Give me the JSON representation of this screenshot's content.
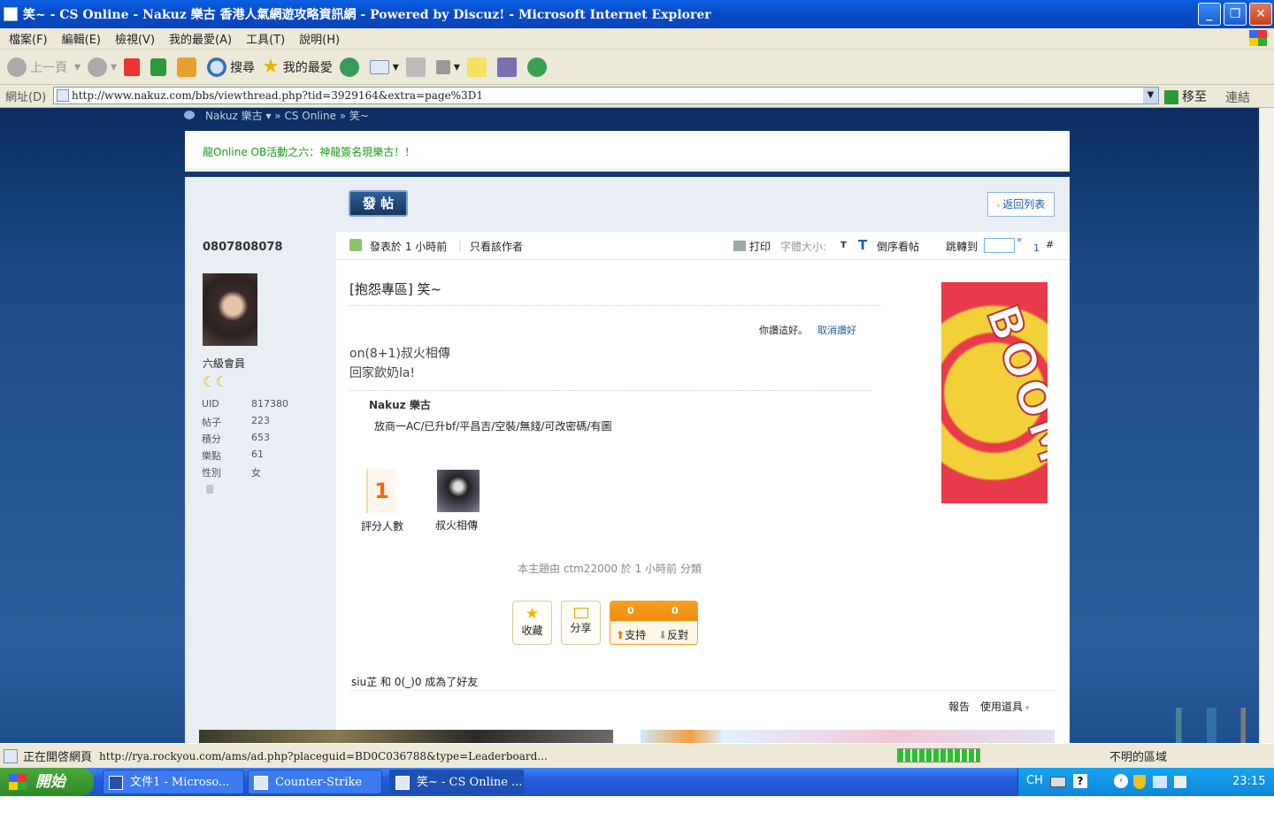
{
  "window": {
    "title": "笑~ - CS Online - Nakuz 樂古 香港人氣網遊攻略資訊網 - Powered by Discuz! - Microsoft Internet Explorer"
  },
  "menubar": [
    "檔案(F)",
    "編輯(E)",
    "檢視(V)",
    "我的最愛(A)",
    "工具(T)",
    "說明(H)"
  ],
  "toolbar": {
    "back": "上一頁",
    "search": "搜尋",
    "favorites": "我的最愛"
  },
  "address": {
    "label": "網址(D)",
    "url": "http://www.nakuz.com/bbs/viewthread.php?tid=3929164&extra=page%3D1",
    "go": "移至",
    "links": "連結"
  },
  "breadcrumb": "Nakuz 樂古 ▾ » CS Online » 笑~",
  "notice": "龍Online OB活動之六：神龍簽名現樂古！！",
  "buttons": {
    "post": "發 帖",
    "back_list": "返回列表"
  },
  "user": {
    "name": "0807808078",
    "rank": "六級會員",
    "stats": [
      {
        "k": "UID",
        "v": "817380"
      },
      {
        "k": "帖子",
        "v": "223"
      },
      {
        "k": "積分",
        "v": "653"
      },
      {
        "k": "樂點",
        "v": "61"
      },
      {
        "k": "性別",
        "v": "女"
      }
    ]
  },
  "postbar": {
    "posted": "發表於 1 小時前",
    "only_author": "只看該作者",
    "print": "打印",
    "font_size": "字體大小:",
    "t_small": "T",
    "t_large": "T",
    "reverse": "倒序看帖",
    "jump": "跳轉到",
    "page": "1",
    "hash": "#"
  },
  "post": {
    "title": "[抱怨專區] 笑~",
    "like": "你讚這好。",
    "unlike": "取消讚好",
    "lines": [
      "on(8+1)叔火相傳",
      "回家飲奶la!"
    ],
    "sig_name": "Nakuz 樂古",
    "sig_text": "放商一AC/已升bf/平昌吉/空裝/無錢/可改密碼/有圖",
    "rating_count": "1",
    "rating_label": "評分人數",
    "rater": "叔火相傳",
    "classified": "本主題由 ctm22000 於 1 小時前 分類",
    "fav": "收藏",
    "share": "分享",
    "support_n": "0",
    "oppose_n": "0",
    "support": "支持",
    "oppose": "反對",
    "friend": "siu芷 和 0(_)0 成為了好友",
    "report": "報告",
    "tools": "使用道具"
  },
  "ad": {
    "text": "BOOM"
  },
  "status": {
    "loading": "正在開啓網頁",
    "url": "http://rya.rockyou.com/ams/ad.php?placeguid=BD0C036788&type=Leaderboard...",
    "zone": "不明的區域"
  },
  "taskbar": {
    "start": "開始",
    "tasks": [
      "文件1 - Microso...",
      "Counter-Strike O...",
      "笑~ - CS Online ..."
    ],
    "lang": "CH",
    "time": "23:15"
  },
  "colors": {
    "title_blue": "#0a5fe0",
    "notice_green": "#1a9a1a",
    "link_blue": "#1c5ea8",
    "rating_orange": "#f26a10"
  }
}
